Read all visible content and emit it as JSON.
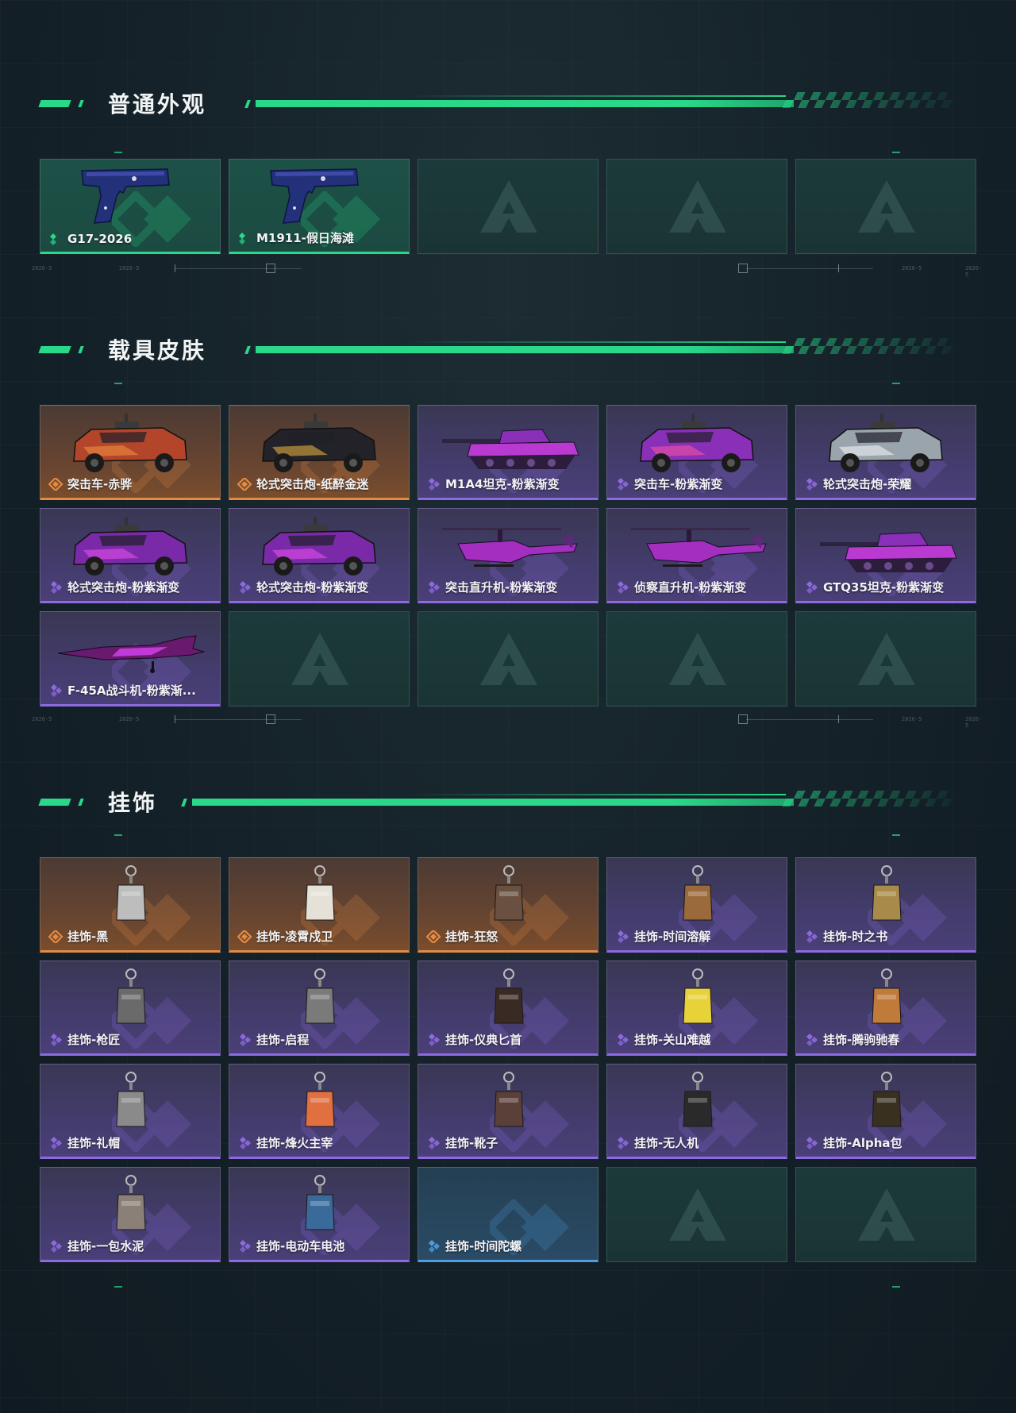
{
  "sections": {
    "normal": {
      "title": "普通外观",
      "items": [
        {
          "label": "G17-2026",
          "rarity": "green"
        },
        {
          "label": "M1911-假日海滩",
          "rarity": "green"
        }
      ]
    },
    "vehicle": {
      "title": "载具皮肤",
      "items": [
        {
          "label": "突击车-赤骅",
          "rarity": "orange"
        },
        {
          "label": "轮式突击炮-纸醉金迷",
          "rarity": "orange"
        },
        {
          "label": "M1A4坦克-粉紫渐变",
          "rarity": "purple"
        },
        {
          "label": "突击车-粉紫渐变",
          "rarity": "purple"
        },
        {
          "label": "轮式突击炮-荣耀",
          "rarity": "purple"
        },
        {
          "label": "轮式突击炮-粉紫渐变",
          "rarity": "purple"
        },
        {
          "label": "轮式突击炮-粉紫渐变",
          "rarity": "purple"
        },
        {
          "label": "突击直升机-粉紫渐变",
          "rarity": "purple"
        },
        {
          "label": "侦察直升机-粉紫渐变",
          "rarity": "purple"
        },
        {
          "label": "GTQ35坦克-粉紫渐变",
          "rarity": "purple"
        },
        {
          "label": "F-45A战斗机-粉紫渐...",
          "rarity": "purple"
        }
      ]
    },
    "charm": {
      "title": "挂饰",
      "items": [
        {
          "label": "挂饰-黑",
          "rarity": "orange"
        },
        {
          "label": "挂饰-凌霄戍卫",
          "rarity": "orange"
        },
        {
          "label": "挂饰-狂怒",
          "rarity": "orange"
        },
        {
          "label": "挂饰-时间溶解",
          "rarity": "purple"
        },
        {
          "label": "挂饰-时之书",
          "rarity": "purple"
        },
        {
          "label": "挂饰-枪匠",
          "rarity": "purple"
        },
        {
          "label": "挂饰-启程",
          "rarity": "purple"
        },
        {
          "label": "挂饰-仪典匕首",
          "rarity": "purple"
        },
        {
          "label": "挂饰-关山难越",
          "rarity": "purple"
        },
        {
          "label": "挂饰-腾驹驰春",
          "rarity": "purple"
        },
        {
          "label": "挂饰-礼帽",
          "rarity": "purple"
        },
        {
          "label": "挂饰-烽火主宰",
          "rarity": "purple"
        },
        {
          "label": "挂饰-靴子",
          "rarity": "purple"
        },
        {
          "label": "挂饰-无人机",
          "rarity": "purple"
        },
        {
          "label": "挂饰-Alpha包",
          "rarity": "purple"
        },
        {
          "label": "挂饰-一包水泥",
          "rarity": "purple"
        },
        {
          "label": "挂饰-电动车电池",
          "rarity": "purple"
        },
        {
          "label": "挂饰-时间陀螺",
          "rarity": "blue"
        }
      ]
    }
  },
  "colors": {
    "accent": "#29d889",
    "green": "#29d889",
    "orange": "#e38a43",
    "purple": "#8d6ae0",
    "blue": "#4f9ddc"
  }
}
